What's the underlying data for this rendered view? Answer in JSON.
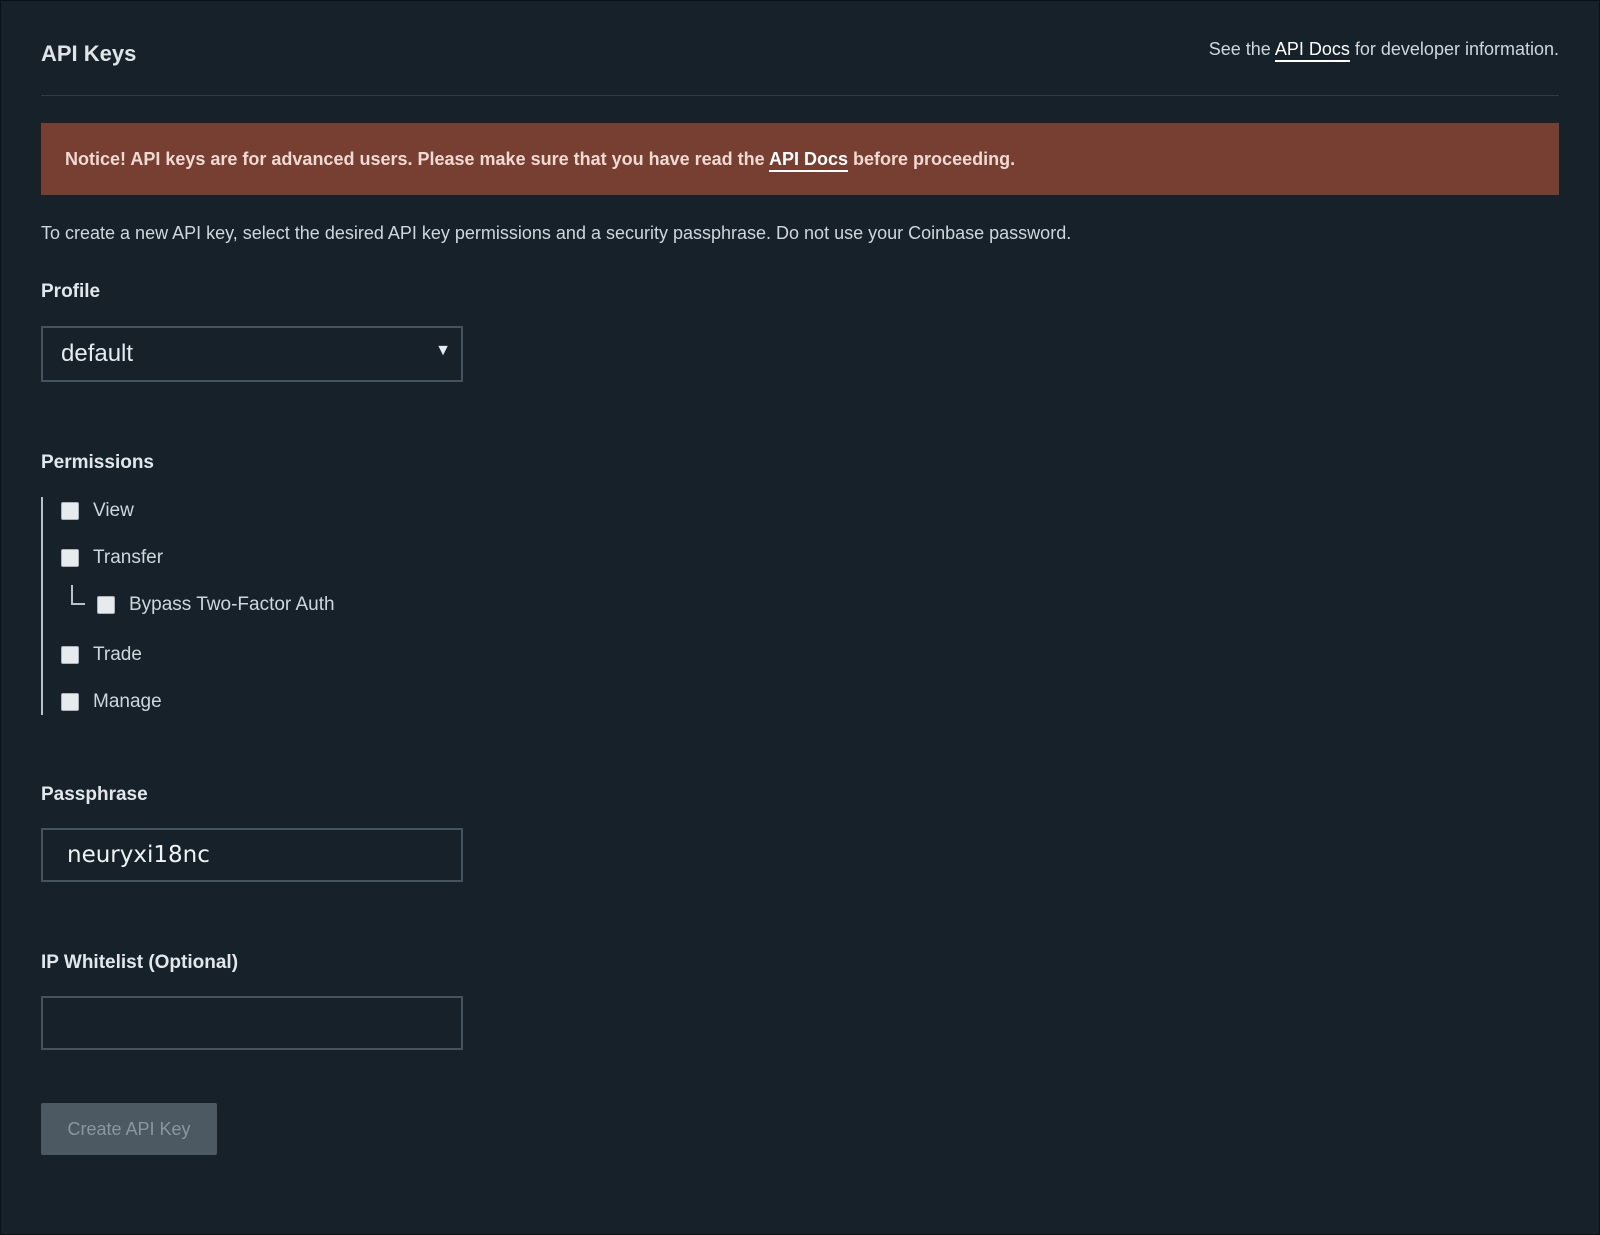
{
  "page": {
    "title": "API Keys"
  },
  "header": {
    "info_prefix": "See the",
    "info_link": "API Docs",
    "info_suffix": "for developer information."
  },
  "notice": {
    "prefix": "Notice! API keys are for advanced users. Please make sure that you have read the",
    "link": "API Docs",
    "suffix": "before proceeding."
  },
  "intro_text": "To create a new API key, select the desired API key permissions and a security passphrase. Do not use your Coinbase password.",
  "profile": {
    "label": "Profile",
    "selected": "default"
  },
  "permissions": {
    "label": "Permissions",
    "items": [
      {
        "label": "View",
        "checked": false
      },
      {
        "label": "Transfer",
        "checked": false
      },
      {
        "label": "Bypass Two-Factor Auth",
        "checked": false
      },
      {
        "label": "Trade",
        "checked": false
      },
      {
        "label": "Manage",
        "checked": false
      }
    ]
  },
  "passphrase": {
    "label": "Passphrase",
    "value": "neuryxi18nc"
  },
  "ip_whitelist": {
    "label": "IP Whitelist (Optional)",
    "value": ""
  },
  "create_button": {
    "label": "Create API Key"
  },
  "colors": {
    "background": "#16212a",
    "notice_background": "#763f31",
    "button_disabled": "#4c5962"
  }
}
